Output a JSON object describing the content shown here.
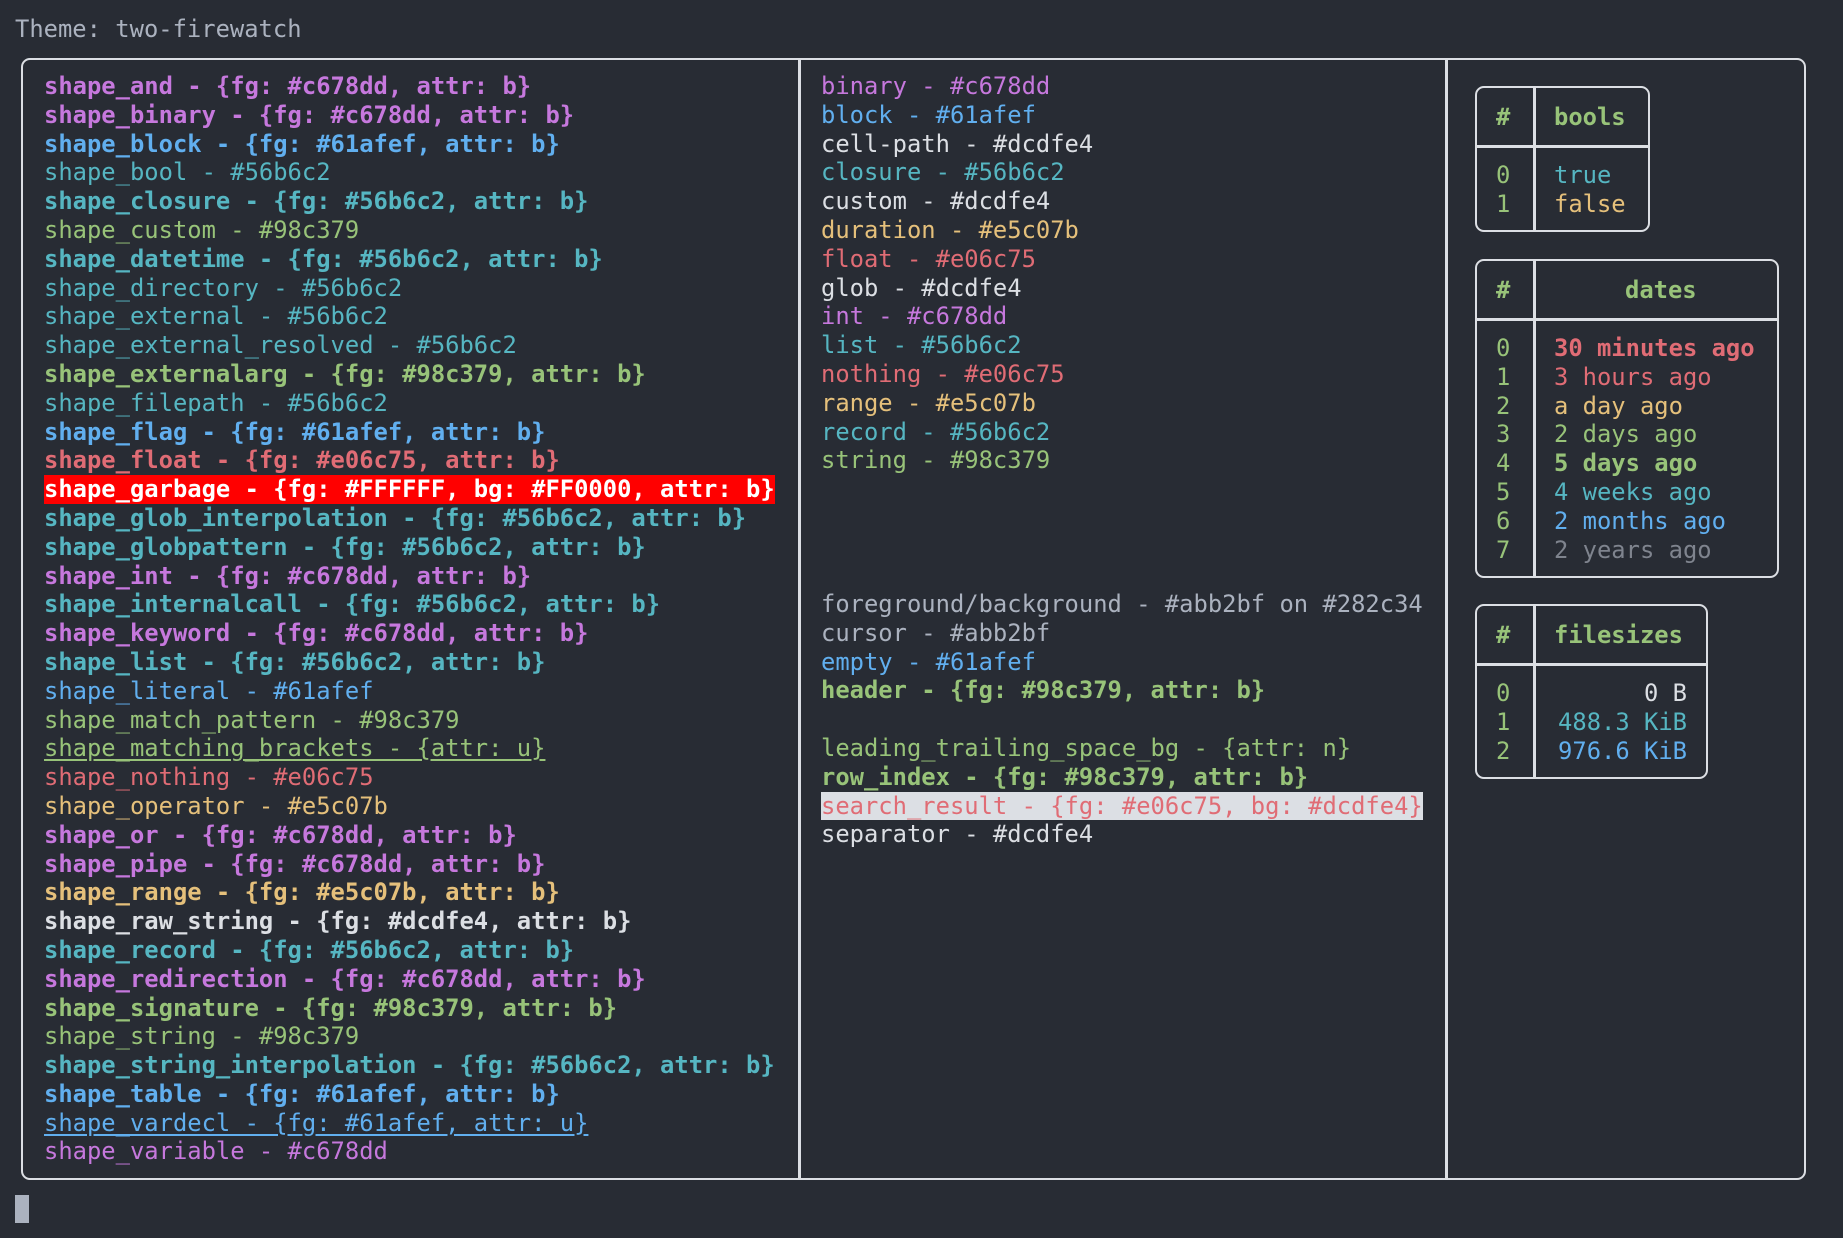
{
  "theme_label": "Theme: two-firewatch",
  "colors": {
    "background": "#282c34",
    "foreground": "#abb2bf",
    "border": "#dcdfe4",
    "purple": "#c678dd",
    "blue": "#61afef",
    "teal": "#56b6c2",
    "green": "#98c379",
    "red": "#e06c75",
    "yellow": "#e5c07b",
    "white": "#dcdfe4",
    "gray": "#7f848e",
    "garbage_fg": "#FFFFFF",
    "garbage_bg": "#FF0000"
  },
  "shapes": [
    {
      "text": "shape_and - {fg: #c678dd, attr: b}",
      "fg": "#c678dd",
      "bold": true
    },
    {
      "text": "shape_binary - {fg: #c678dd, attr: b}",
      "fg": "#c678dd",
      "bold": true
    },
    {
      "text": "shape_block - {fg: #61afef, attr: b}",
      "fg": "#61afef",
      "bold": true
    },
    {
      "text": "shape_bool - #56b6c2",
      "fg": "#56b6c2"
    },
    {
      "text": "shape_closure - {fg: #56b6c2, attr: b}",
      "fg": "#56b6c2",
      "bold": true
    },
    {
      "text": "shape_custom - #98c379",
      "fg": "#98c379"
    },
    {
      "text": "shape_datetime - {fg: #56b6c2, attr: b}",
      "fg": "#56b6c2",
      "bold": true
    },
    {
      "text": "shape_directory - #56b6c2",
      "fg": "#56b6c2"
    },
    {
      "text": "shape_external - #56b6c2",
      "fg": "#56b6c2"
    },
    {
      "text": "shape_external_resolved - #56b6c2",
      "fg": "#56b6c2"
    },
    {
      "text": "shape_externalarg - {fg: #98c379, attr: b}",
      "fg": "#98c379",
      "bold": true
    },
    {
      "text": "shape_filepath - #56b6c2",
      "fg": "#56b6c2"
    },
    {
      "text": "shape_flag - {fg: #61afef, attr: b}",
      "fg": "#61afef",
      "bold": true
    },
    {
      "text": "shape_float - {fg: #e06c75, attr: b}",
      "fg": "#e06c75",
      "bold": true
    },
    {
      "text": "shape_garbage - {fg: #FFFFFF, bg: #FF0000, attr: b}",
      "fg": "#FFFFFF",
      "bg": "#FF0000",
      "bold": true
    },
    {
      "text": "shape_glob_interpolation - {fg: #56b6c2, attr: b}",
      "fg": "#56b6c2",
      "bold": true
    },
    {
      "text": "shape_globpattern - {fg: #56b6c2, attr: b}",
      "fg": "#56b6c2",
      "bold": true
    },
    {
      "text": "shape_int - {fg: #c678dd, attr: b}",
      "fg": "#c678dd",
      "bold": true
    },
    {
      "text": "shape_internalcall - {fg: #56b6c2, attr: b}",
      "fg": "#56b6c2",
      "bold": true
    },
    {
      "text": "shape_keyword - {fg: #c678dd, attr: b}",
      "fg": "#c678dd",
      "bold": true
    },
    {
      "text": "shape_list - {fg: #56b6c2, attr: b}",
      "fg": "#56b6c2",
      "bold": true
    },
    {
      "text": "shape_literal - #61afef",
      "fg": "#61afef"
    },
    {
      "text": "shape_match_pattern - #98c379",
      "fg": "#98c379"
    },
    {
      "text": "shape_matching_brackets - {attr: u}",
      "fg": "#98c379",
      "underline": true
    },
    {
      "text": "shape_nothing - #e06c75",
      "fg": "#e06c75"
    },
    {
      "text": "shape_operator - #e5c07b",
      "fg": "#e5c07b"
    },
    {
      "text": "shape_or - {fg: #c678dd, attr: b}",
      "fg": "#c678dd",
      "bold": true
    },
    {
      "text": "shape_pipe - {fg: #c678dd, attr: b}",
      "fg": "#c678dd",
      "bold": true
    },
    {
      "text": "shape_range - {fg: #e5c07b, attr: b}",
      "fg": "#e5c07b",
      "bold": true
    },
    {
      "text": "shape_raw_string - {fg: #dcdfe4, attr: b}",
      "fg": "#dcdfe4",
      "bold": true
    },
    {
      "text": "shape_record - {fg: #56b6c2, attr: b}",
      "fg": "#56b6c2",
      "bold": true
    },
    {
      "text": "shape_redirection - {fg: #c678dd, attr: b}",
      "fg": "#c678dd",
      "bold": true
    },
    {
      "text": "shape_signature - {fg: #98c379, attr: b}",
      "fg": "#98c379",
      "bold": true
    },
    {
      "text": "shape_string - #98c379",
      "fg": "#98c379"
    },
    {
      "text": "shape_string_interpolation - {fg: #56b6c2, attr: b}",
      "fg": "#56b6c2",
      "bold": true
    },
    {
      "text": "shape_table - {fg: #61afef, attr: b}",
      "fg": "#61afef",
      "bold": true
    },
    {
      "text": "shape_vardecl - {fg: #61afef, attr: u}",
      "fg": "#61afef",
      "underline": true
    },
    {
      "text": "shape_variable - #c678dd",
      "fg": "#c678dd"
    }
  ],
  "types": [
    {
      "text": "binary - #c678dd",
      "fg": "#c678dd"
    },
    {
      "text": "block - #61afef",
      "fg": "#61afef"
    },
    {
      "text": "cell-path - #dcdfe4",
      "fg": "#dcdfe4"
    },
    {
      "text": "closure - #56b6c2",
      "fg": "#56b6c2"
    },
    {
      "text": "custom - #dcdfe4",
      "fg": "#dcdfe4"
    },
    {
      "text": "duration - #e5c07b",
      "fg": "#e5c07b"
    },
    {
      "text": "float - #e06c75",
      "fg": "#e06c75"
    },
    {
      "text": "glob - #dcdfe4",
      "fg": "#dcdfe4"
    },
    {
      "text": "int - #c678dd",
      "fg": "#c678dd"
    },
    {
      "text": "list - #56b6c2",
      "fg": "#56b6c2"
    },
    {
      "text": "nothing - #e06c75",
      "fg": "#e06c75"
    },
    {
      "text": "range - #e5c07b",
      "fg": "#e5c07b"
    },
    {
      "text": "record - #56b6c2",
      "fg": "#56b6c2"
    },
    {
      "text": "string - #98c379",
      "fg": "#98c379"
    }
  ],
  "ui_colors": [
    {
      "text": "foreground/background - #abb2bf on #282c34",
      "fg": "#abb2bf"
    },
    {
      "text": "cursor - #abb2bf",
      "fg": "#abb2bf"
    },
    {
      "text": "empty - #61afef",
      "fg": "#61afef"
    },
    {
      "text": "header - {fg: #98c379, attr: b}",
      "fg": "#98c379",
      "bold": true
    },
    {
      "text": "",
      "fg": "#abb2bf"
    },
    {
      "text": "leading_trailing_space_bg - {attr: n}",
      "fg": "#98c379"
    },
    {
      "text": "row_index - {fg: #98c379, attr: b}",
      "fg": "#98c379",
      "bold": true
    },
    {
      "text": "search_result - {fg: #e06c75, bg: #dcdfe4}",
      "fg": "#e06c75",
      "bg": "#dcdfe4"
    },
    {
      "text": "separator - #dcdfe4",
      "fg": "#dcdfe4"
    }
  ],
  "tables": {
    "bools": {
      "index_header": "#",
      "header": "bools",
      "rows": [
        {
          "index": "0",
          "value": "true",
          "fg": "#56b6c2"
        },
        {
          "index": "1",
          "value": "false",
          "fg": "#e5c07b"
        }
      ]
    },
    "dates": {
      "index_header": "#",
      "header": "dates",
      "rows": [
        {
          "index": "0",
          "value": "30 minutes ago",
          "fg": "#e06c75",
          "bold": true
        },
        {
          "index": "1",
          "value": "3 hours ago",
          "fg": "#e06c75"
        },
        {
          "index": "2",
          "value": "a day ago",
          "fg": "#e5c07b"
        },
        {
          "index": "3",
          "value": "2 days ago",
          "fg": "#98c379"
        },
        {
          "index": "4",
          "value": "5 days ago",
          "fg": "#98c379",
          "bold": true
        },
        {
          "index": "5",
          "value": "4 weeks ago",
          "fg": "#56b6c2"
        },
        {
          "index": "6",
          "value": "2 months ago",
          "fg": "#61afef"
        },
        {
          "index": "7",
          "value": "2 years ago",
          "fg": "#7f848e"
        }
      ]
    },
    "filesizes": {
      "index_header": "#",
      "header": "filesizes",
      "rows": [
        {
          "index": "0",
          "value": "0 B",
          "fg": "#dcdfe4"
        },
        {
          "index": "1",
          "value": "488.3 KiB",
          "fg": "#56b6c2"
        },
        {
          "index": "2",
          "value": "976.6 KiB",
          "fg": "#61afef"
        }
      ]
    }
  }
}
